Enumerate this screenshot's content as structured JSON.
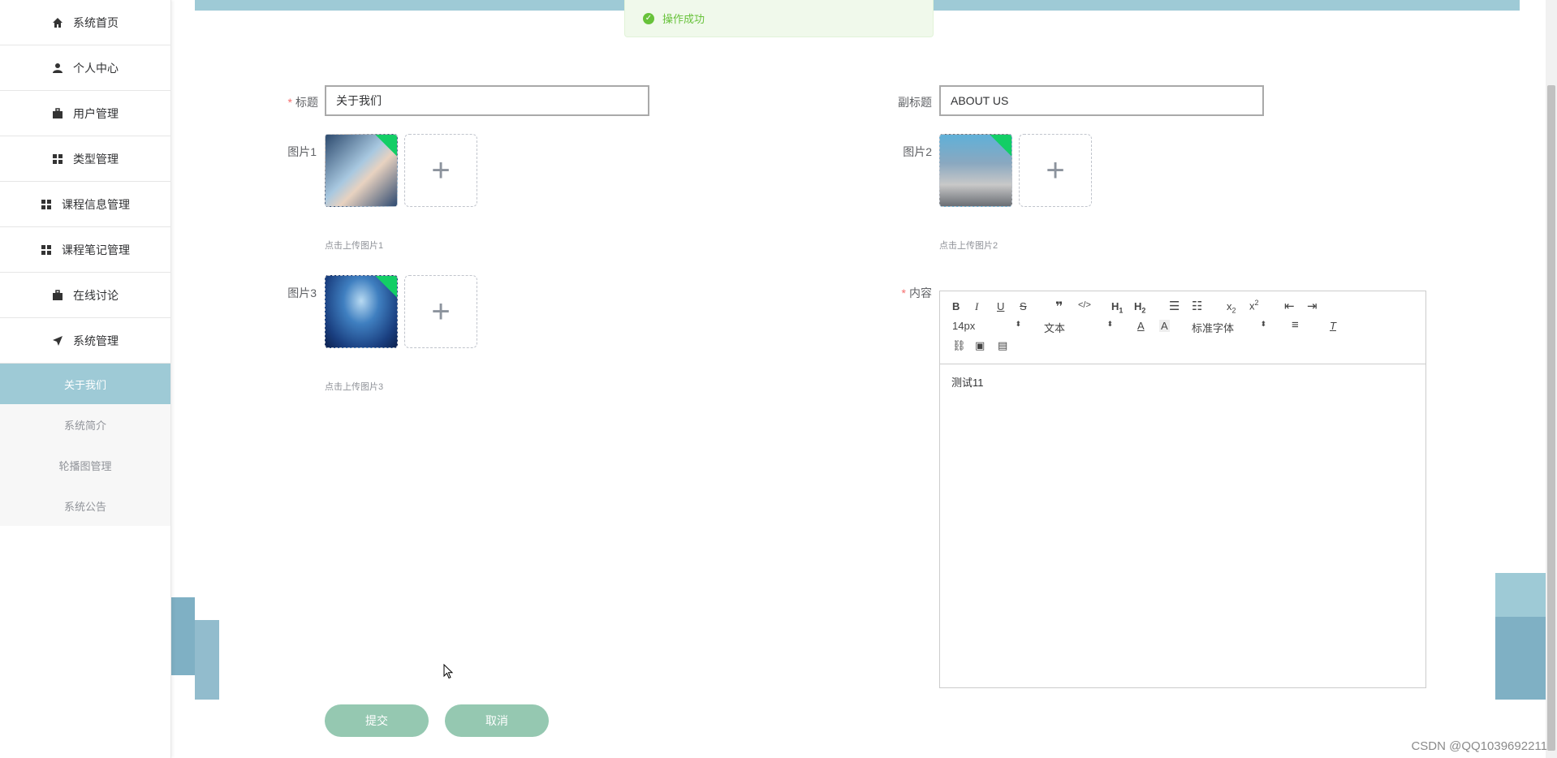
{
  "sidebar": {
    "items": [
      {
        "label": "系统首页",
        "icon": "home-icon"
      },
      {
        "label": "个人中心",
        "icon": "user-icon"
      },
      {
        "label": "用户管理",
        "icon": "briefcase-icon"
      },
      {
        "label": "类型管理",
        "icon": "grid-icon"
      },
      {
        "label": "课程信息管理",
        "icon": "grid-icon"
      },
      {
        "label": "课程笔记管理",
        "icon": "grid-icon"
      },
      {
        "label": "在线讨论",
        "icon": "briefcase-icon"
      },
      {
        "label": "系统管理",
        "icon": "paper-plane-icon"
      }
    ],
    "subitems": [
      {
        "label": "关于我们",
        "active": true
      },
      {
        "label": "系统简介",
        "active": false
      },
      {
        "label": "轮播图管理",
        "active": false
      },
      {
        "label": "系统公告",
        "active": false
      }
    ]
  },
  "toast": {
    "message": "操作成功"
  },
  "form": {
    "title_label": "标题",
    "title_value": "关于我们",
    "subtitle_label": "副标题",
    "subtitle_value": "ABOUT US",
    "image1_label": "图片1",
    "image1_tip": "点击上传图片1",
    "image2_label": "图片2",
    "image2_tip": "点击上传图片2",
    "image3_label": "图片3",
    "image3_tip": "点击上传图片3",
    "content_label": "内容",
    "upload_plus": "+"
  },
  "editor": {
    "font_size": "14px",
    "block_type": "文本",
    "font_family": "标准字体",
    "content": "测试11"
  },
  "buttons": {
    "submit": "提交",
    "cancel": "取消"
  },
  "watermark": "CSDN @QQ1039692211",
  "colors": {
    "accent": "#9ecad6",
    "button": "#95c8b1",
    "success": "#67c23a",
    "required": "#f56c6c"
  }
}
